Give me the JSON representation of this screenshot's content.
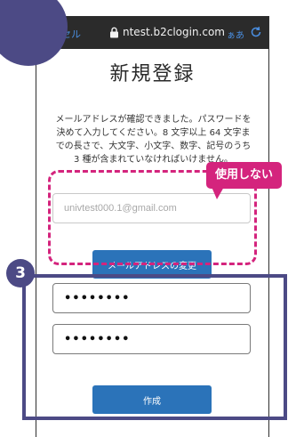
{
  "browser": {
    "cancel_label": "ャンセル",
    "url": "ntest.b2clogin.com",
    "text_size_label": "ぁあ"
  },
  "form": {
    "title": "新規登録",
    "description": "メールアドレスが確認できました。パスワードを決めて入力してください。8 文字以上 64 文字までの長さで、大文字、小文字、数字、記号のうち 3 種が含まれていなければいけません。",
    "email_placeholder": "univtest000.1@gmail.com",
    "change_email_label": "メールアドレスの変更",
    "password_value": "••••••••",
    "confirm_password_value": "••••••••",
    "create_label": "作成"
  },
  "annotations": {
    "callout_text": "使用しない",
    "step_number": "3",
    "accent_color": "#d4247d",
    "step_color": "#4c4a85"
  },
  "colors": {
    "button_blue": "#2b73b9",
    "browser_bar": "#2b2b2b"
  },
  "icons": [
    "lock-icon",
    "reload-icon"
  ]
}
